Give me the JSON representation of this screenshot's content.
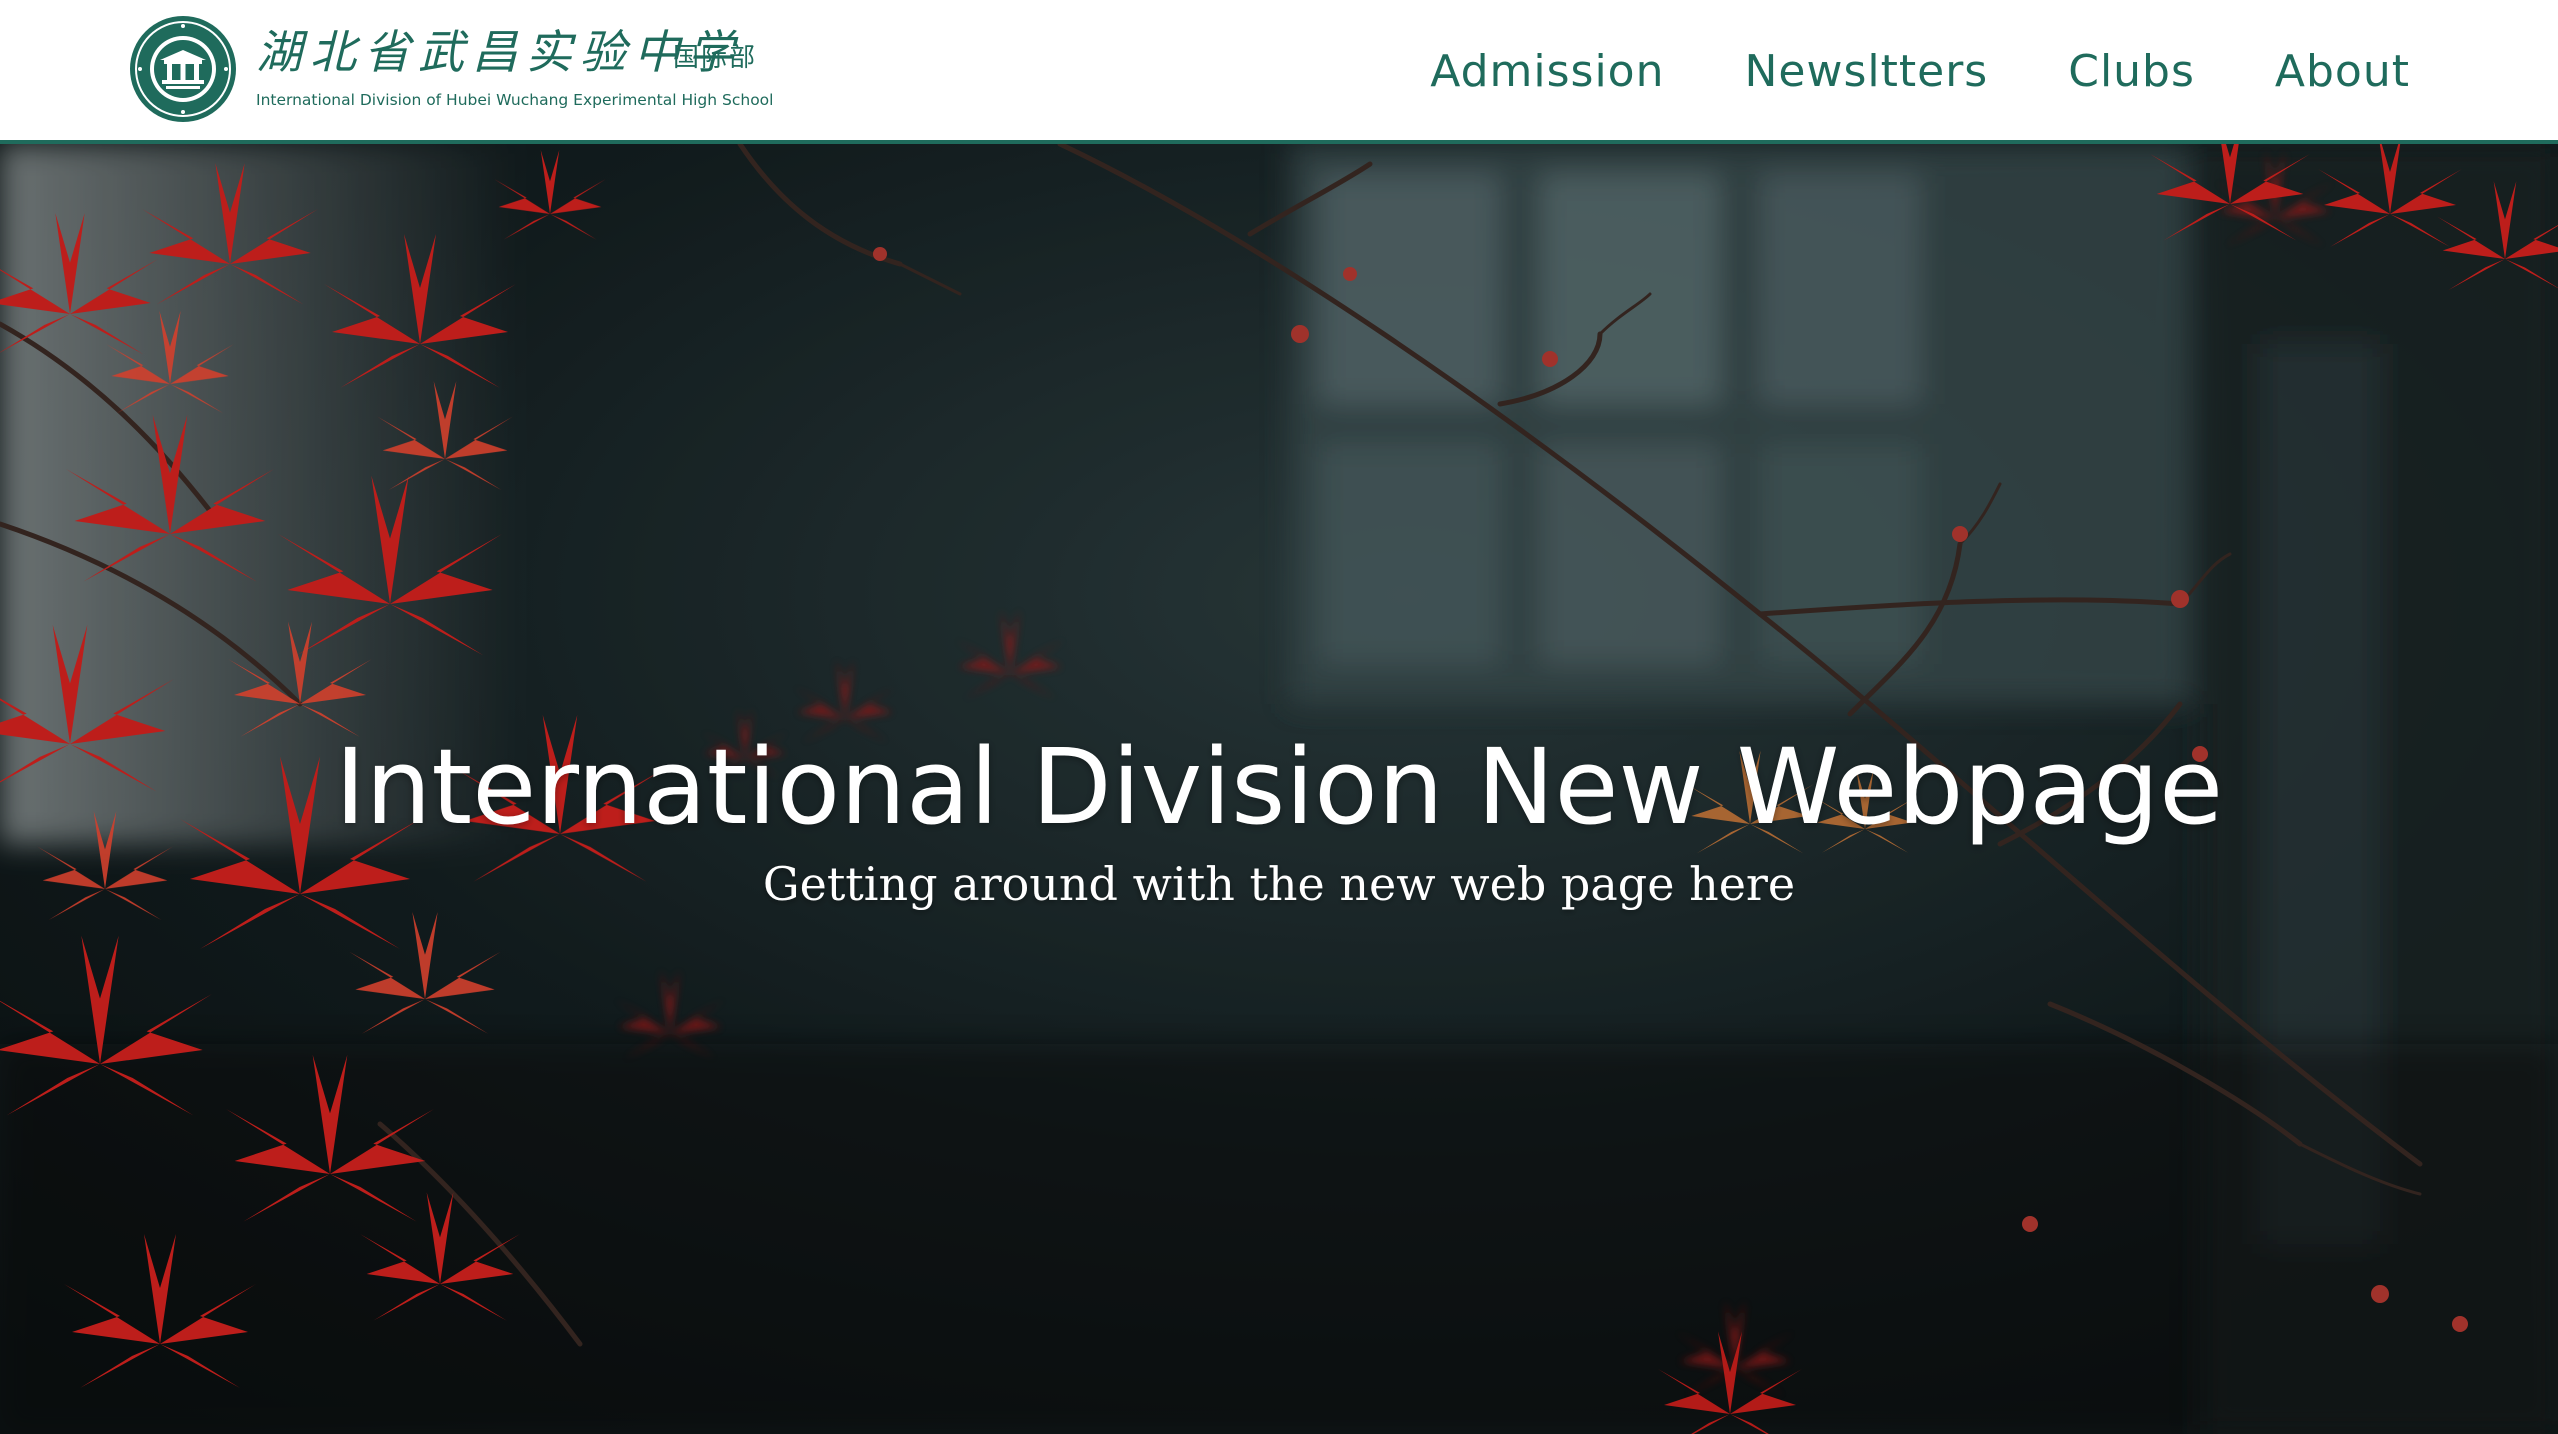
{
  "header": {
    "logo": {
      "cn_name": "湖北省武昌实验中学",
      "cn_tag": "国际部",
      "en_name": "International Division of Hubei Wuchang Experimental High School",
      "seal_icon": "school-seal-icon"
    },
    "nav": [
      {
        "label": "Admission"
      },
      {
        "label": "Newsltters"
      },
      {
        "label": "Clubs"
      },
      {
        "label": "About"
      }
    ]
  },
  "hero": {
    "title": "International Division New Webpage",
    "subtitle": "Getting around with the new web page here",
    "background_description_icon": "red-maple-leaves-photo"
  },
  "colors": {
    "brand_green": "#1f6b5c",
    "header_bg": "#ffffff",
    "hero_text": "#ffffff",
    "maple_red": "#d8231f"
  }
}
